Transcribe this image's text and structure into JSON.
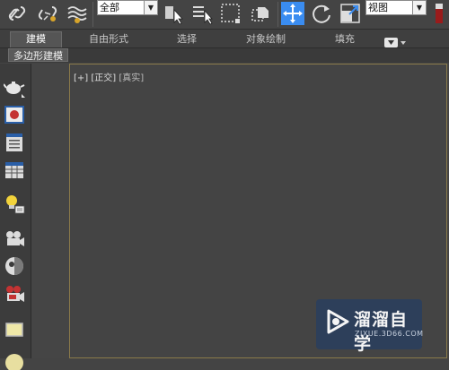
{
  "toolbar": {
    "selection_filter": "全部",
    "reference_coord": "视图"
  },
  "ribbon": {
    "tabs": [
      "建模",
      "自由形式",
      "选择",
      "对象绘制",
      "填充"
    ],
    "active_tab": "建模",
    "sub_panel": "多边形建模"
  },
  "viewport": {
    "menu_plus": "[+]",
    "view_name": "[正交]",
    "shading": "[真实]"
  },
  "watermark": {
    "title": "溜溜自学",
    "url": "ZIXUE.3D66.COM"
  },
  "colors": {
    "active_tool": "#3a8cf0",
    "viewport_border": "#8a7a4a",
    "watermark_bg": "#2c3f5c"
  }
}
